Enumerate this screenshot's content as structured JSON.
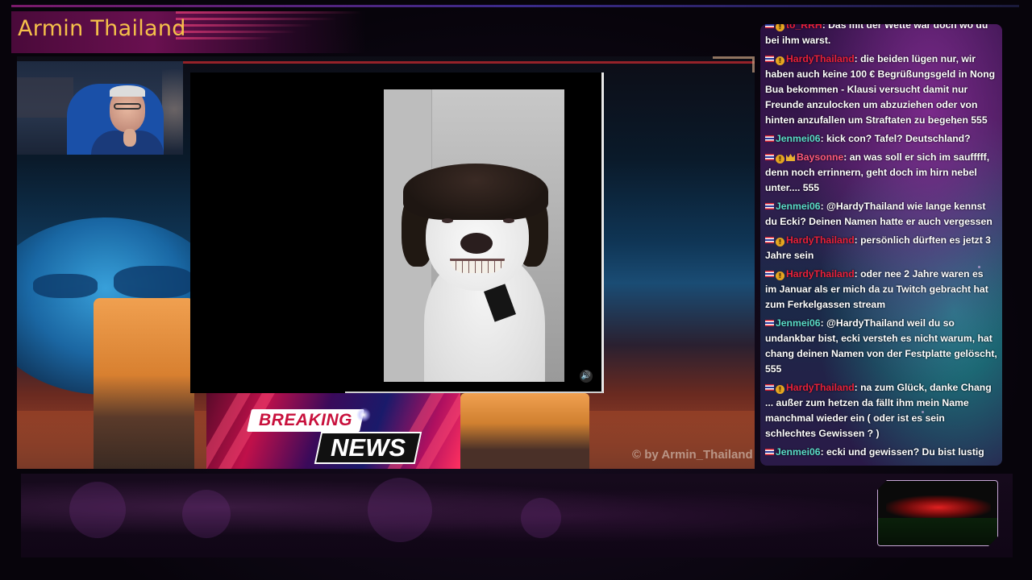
{
  "stream": {
    "title": "Armin Thailand",
    "watermark": "© by Armin_Thailand"
  },
  "video": {
    "volume_icon": "speaker-icon",
    "volume_glyph": "🔊"
  },
  "breaking_news": {
    "line1": "BREAKING",
    "line2": "NEWS"
  },
  "chat": {
    "messages": [
      {
        "badges": [
          "flag",
          "coin"
        ],
        "user": "to_RRH",
        "user_color": "red",
        "text": ": Das mit der Wette war doch wo du bei ihm warst.",
        "cut": true
      },
      {
        "badges": [
          "flag",
          "coin"
        ],
        "user": "HardyThailand",
        "user_color": "red",
        "text": ": die beiden lügen nur, wir haben auch keine 100 € Begrüßungsgeld in Nong Bua bekommen - Klausi versucht damit nur Freunde anzulocken um abzuziehen oder von hinten anzufallen um Straftaten zu begehen 555"
      },
      {
        "badges": [
          "flag"
        ],
        "user": "Jenmei06",
        "user_color": "teal",
        "text": ": kick con? Tafel? Deutschland?"
      },
      {
        "badges": [
          "flag",
          "coin",
          "crown"
        ],
        "user": "Baysonne",
        "user_color": "pink",
        "text": ": an was soll er sich im saufffff, denn noch errinnern, geht doch im hirn nebel unter.... 555"
      },
      {
        "badges": [
          "flag"
        ],
        "user": "Jenmei06",
        "user_color": "teal",
        "text": ": @HardyThailand wie lange kennst du Ecki? Deinen Namen hatte er auch vergessen"
      },
      {
        "badges": [
          "flag",
          "coin"
        ],
        "user": "HardyThailand",
        "user_color": "red",
        "text": ": persönlich dürften es jetzt 3 Jahre sein"
      },
      {
        "badges": [
          "flag",
          "coin"
        ],
        "user": "HardyThailand",
        "user_color": "red",
        "text": ": oder nee 2 Jahre waren es im Januar als er mich da zu Twitch gebracht hat zum Ferkelgassen stream"
      },
      {
        "badges": [
          "flag"
        ],
        "user": "Jenmei06",
        "user_color": "teal",
        "text": ": @HardyThailand weil du so undankbar bist, ecki versteh es nicht warum, hat chang deinen Namen von der Festplatte gelöscht, 555"
      },
      {
        "badges": [
          "flag",
          "coin"
        ],
        "user": "HardyThailand",
        "user_color": "red",
        "text": ": na zum Glück, danke Chang ... außer zum hetzen da fällt ihm mein Name manchmal wieder ein ( oder ist es sein schlechtes Gewissen ? )"
      },
      {
        "badges": [
          "flag"
        ],
        "user": "Jenmei06",
        "user_color": "teal",
        "text": ": ecki und gewissen? Du bist lustig"
      }
    ]
  }
}
